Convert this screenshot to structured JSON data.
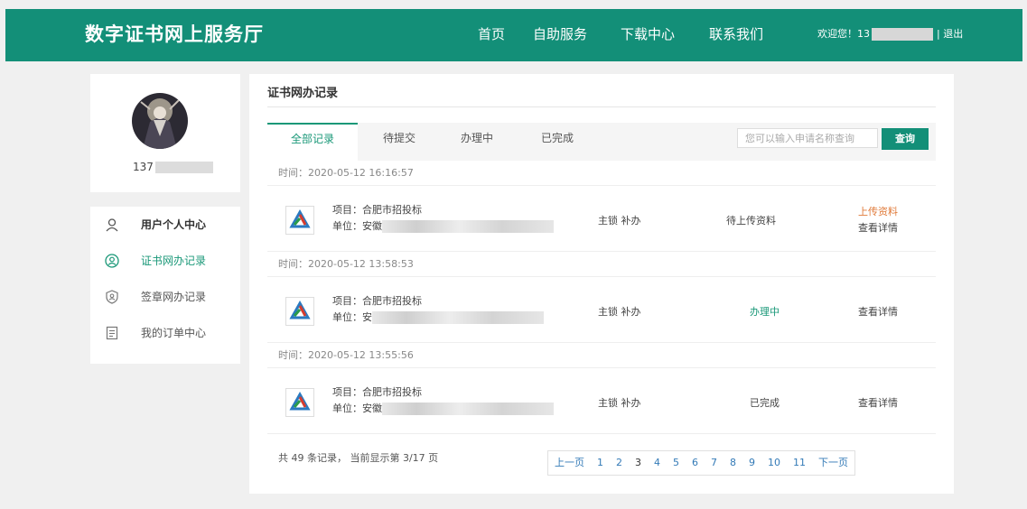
{
  "header": {
    "site_title": "数字证书网上服务厅",
    "nav": [
      "首页",
      "自助服务",
      "下载中心",
      "联系我们"
    ],
    "welcome_prefix": "欢迎您！13",
    "separator": "|",
    "logout": "退出"
  },
  "profile": {
    "username_visible": "137"
  },
  "sidebar": {
    "items": [
      {
        "label": "用户个人中心",
        "icon": "user-icon"
      },
      {
        "label": "证书网办记录",
        "icon": "user-circle-icon"
      },
      {
        "label": "签章网办记录",
        "icon": "seal-shield-icon"
      },
      {
        "label": "我的订单中心",
        "icon": "document-icon"
      }
    ]
  },
  "main": {
    "title": "证书网办记录",
    "tabs": [
      "全部记录",
      "待提交",
      "办理中",
      "已完成"
    ],
    "search": {
      "placeholder": "您可以输入申请名称查询",
      "button": "查询"
    },
    "records": [
      {
        "time": "时间：2020-05-12 16:16:57",
        "project": "项目：合肥市招投标",
        "unit": "单位：安徽",
        "type": "主锁 补办",
        "status": "待上传资料",
        "upload": "上传资料",
        "detail": "查看详情"
      },
      {
        "time": "时间：2020-05-12 13:58:53",
        "project": "项目：合肥市招投标",
        "unit": "单位：安",
        "type": "主锁 补办",
        "status": "办理中",
        "detail": "查看详情"
      },
      {
        "time": "时间：2020-05-12 13:55:56",
        "project": "项目：合肥市招投标",
        "unit": "单位：安徽",
        "type": "主锁 补办",
        "status": "已完成",
        "detail": "查看详情"
      }
    ],
    "summary": "共 49 条记录， 当前显示第 3/17 页",
    "pagination": {
      "prev": "上一页",
      "pages": [
        "1",
        "2",
        "3",
        "4",
        "5",
        "6",
        "7",
        "8",
        "9",
        "10",
        "11"
      ],
      "current": "3",
      "next": "下一页"
    }
  },
  "colors": {
    "brand": "#138f78",
    "accent": "#1a9878",
    "warn": "#e07a3a",
    "link": "#337ab7"
  }
}
